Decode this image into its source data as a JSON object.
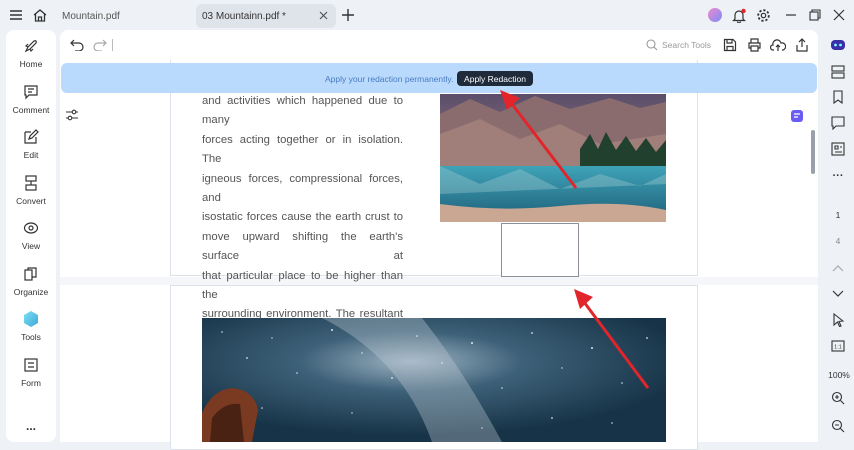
{
  "window": {
    "tabs": [
      {
        "label": "Mountain.pdf",
        "active": false
      },
      {
        "label": "03 Mountainn.pdf *",
        "active": true
      }
    ]
  },
  "sidebar": {
    "items": [
      {
        "label": "Home",
        "icon": "rocket-icon"
      },
      {
        "label": "Comment",
        "icon": "comment-icon"
      },
      {
        "label": "Edit",
        "icon": "edit-icon"
      },
      {
        "label": "Convert",
        "icon": "convert-icon"
      },
      {
        "label": "View",
        "icon": "view-icon"
      },
      {
        "label": "Organize",
        "icon": "organize-icon"
      },
      {
        "label": "Tools",
        "icon": "tools-icon"
      },
      {
        "label": "Form",
        "icon": "form-icon"
      }
    ],
    "more": "..."
  },
  "toolbar": {
    "search_placeholder": "Search Tools"
  },
  "banner": {
    "message": "Apply your redaction permanently.",
    "apply_label": "Apply Redaction"
  },
  "document": {
    "lines": [
      "and activities which happened due to many",
      "forces acting together or in isolation. The",
      "igneous forces, compressional forces, and",
      "isostatic forces cause the earth crust to",
      "move upward shifting the earth's surface at",
      "that particular place to be higher than the",
      "surrounding environment. The resultant"
    ]
  },
  "rightpanel": {
    "current_page": "1",
    "total_pages": "4",
    "zoom": "100%"
  },
  "colors": {
    "banner_bg": "#b9dafc",
    "apply_button": "#1f2a3a",
    "arrow": "#e2252b"
  }
}
